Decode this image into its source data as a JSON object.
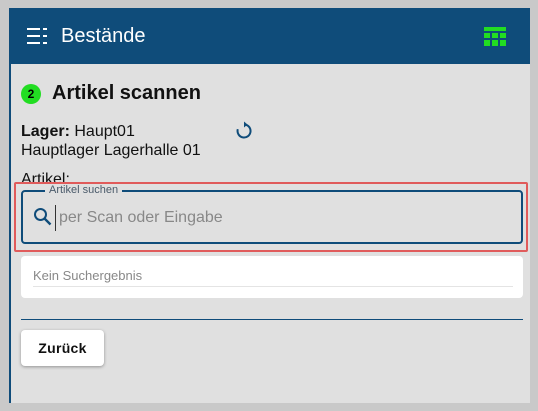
{
  "app": {
    "title": "Bestände",
    "colors": {
      "appbar": "#0f4c7a",
      "step_badge": "#22dd22",
      "table_icon": "#22dd22",
      "highlight": "#e05b5b"
    },
    "icons": {
      "menu": "menu-list-icon",
      "table": "table-icon",
      "refresh": "refresh-icon",
      "search": "search-icon"
    }
  },
  "step": {
    "number": "2",
    "title": "Artikel scannen"
  },
  "lager": {
    "label": "Lager:",
    "code": "Haupt01",
    "name": "Hauptlager Lagerhalle 01"
  },
  "artikel": {
    "label": "Artikel:",
    "search_legend": "Artikel suchen",
    "search_placeholder": "per Scan oder Eingabe",
    "search_value": "",
    "no_result": "Kein Suchergebnis"
  },
  "actions": {
    "back_label": "Zurück"
  }
}
